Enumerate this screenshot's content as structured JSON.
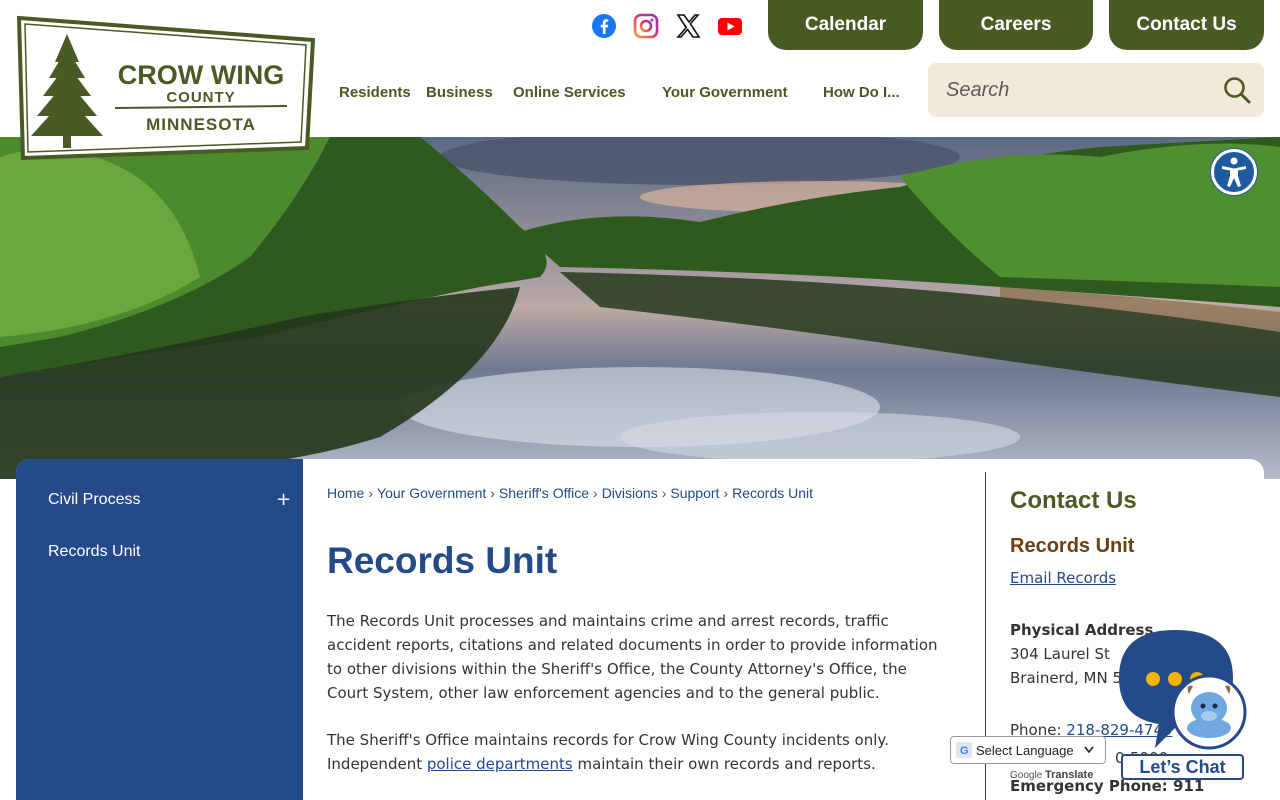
{
  "logo": {
    "line1": "CROW WING",
    "line2": "COUNTY",
    "line3": "MINNESOTA"
  },
  "social": [
    "facebook-icon",
    "instagram-icon",
    "x-twitter-icon",
    "youtube-icon"
  ],
  "top_buttons": {
    "calendar": "Calendar",
    "careers": "Careers",
    "contact": "Contact Us"
  },
  "nav": [
    "Residents",
    "Business",
    "Online Services",
    "Your Government",
    "How Do I..."
  ],
  "search": {
    "placeholder": "Search"
  },
  "sidebar": {
    "items": [
      {
        "label": "Civil Process",
        "expand": "+"
      },
      {
        "label": "Records Unit"
      }
    ]
  },
  "breadcrumb": [
    "Home",
    "Your Government",
    "Sheriff's Office",
    "Divisions",
    "Support",
    "Records Unit"
  ],
  "main": {
    "title": "Records Unit",
    "p1": "The Records Unit processes and maintains crime and arrest records, traffic accident reports, citations and related documents in order to provide information to other divisions within the Sheriff's Office, the County Attorney's Office, the Court System, other law enforcement agencies and to the general public.",
    "p2_before": "The Sheriff's Office maintains records for Crow Wing County incidents only. Independent ",
    "p2_link": "police departments",
    "p2_after": " maintain their own records and reports."
  },
  "contact": {
    "title": "Contact Us",
    "unit": "Records Unit",
    "email_link": "Email Records",
    "address_label": "Physical Address",
    "street": "304 Laurel St",
    "city": "Brainerd, MN 5",
    "phone_label": "Phone: ",
    "phone": "218-829-4749",
    "phone2_partial": "0-5900",
    "emergency": "Emergency Phone: 911"
  },
  "chat": {
    "label": "Let’s Chat"
  },
  "translate": {
    "select": "Select Language",
    "powered_by": "Google",
    "translate": "Translate"
  },
  "colors": {
    "olive": "#4a5a25",
    "navy": "#254a8a",
    "brown": "#6b3f12",
    "search_bg": "#f2e9da"
  }
}
